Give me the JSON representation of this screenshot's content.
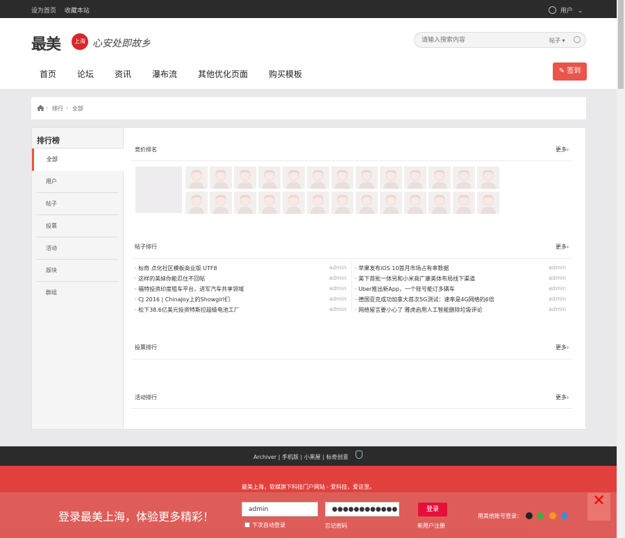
{
  "topbar": {
    "set_home": "设为首页",
    "bookmark": "收藏本站",
    "user": "用户"
  },
  "logo": {
    "brand": "最美",
    "badge": "上海",
    "slogan": "心安处即故乡"
  },
  "search": {
    "placeholder": "请输入搜索内容",
    "type": "帖子"
  },
  "nav": [
    "首页",
    "论坛",
    "资讯",
    "瀑布流",
    "其他优化页面",
    "购买模板"
  ],
  "sign_button": "签到",
  "breadcrumb": {
    "level1": "排行",
    "level2": "全部"
  },
  "sidebar": {
    "title": "排行榜",
    "items": [
      "全部",
      "用户",
      "帖子",
      "投票",
      "活动",
      "版块",
      "群组"
    ]
  },
  "sections": {
    "bid": "竞价排名",
    "posts": "帖子排行",
    "votes": "投票排行",
    "events": "活动排行",
    "more": "更多›"
  },
  "posts_left": [
    {
      "title": "· 标奇 点化社区模板商业版 UTF8",
      "author": "admin"
    },
    {
      "title": "· 这样的美妹你能忍住不回帖",
      "author": "admin"
    },
    {
      "title": "· 福特投资印度租车平台，进军汽车共享领域",
      "author": "admin"
    },
    {
      "title": "· CJ 2016 | ChinaJoy上的Showgirl们",
      "author": "admin"
    },
    {
      "title": "· 松下38.6亿美元投资特斯拉超级电池工厂",
      "author": "admin"
    }
  ],
  "posts_right": [
    {
      "title": "· 苹果发布iOS 10首月市场占有率数据",
      "author": "admin"
    },
    {
      "title": "· 美下首批一体另和小米商广康美体布局线下渠道",
      "author": "admin"
    },
    {
      "title": "· Uber推出新App，一个账号能订多辆车",
      "author": "admin"
    },
    {
      "title": "· 德国亚克成功加拿大首次5G测试：速率是4G网络的6倍",
      "author": "admin"
    },
    {
      "title": "· 网络留言要小心了 雅虎启用人工智能删除垃圾评论",
      "author": "admin"
    }
  ],
  "footer": {
    "links": "Archiver | 手机版 | 小黑屋 | 标奇创意",
    "tagline": "最美上海，软媒旗下科技门户网站 - 爱科技，爱这里。"
  },
  "login": {
    "title": "登录最美上海，体验更多精彩！",
    "username": "admin",
    "password": "●●●●●●●●●●●●",
    "remember": "下次自动登录",
    "forgot": "忘记密码",
    "submit": "登录",
    "register": "新用户注册",
    "other": "用其他账号登录："
  },
  "colors": {
    "accent": "#e9544b",
    "topbar": "#2b2b2b",
    "footer_red": "#e0413d"
  }
}
